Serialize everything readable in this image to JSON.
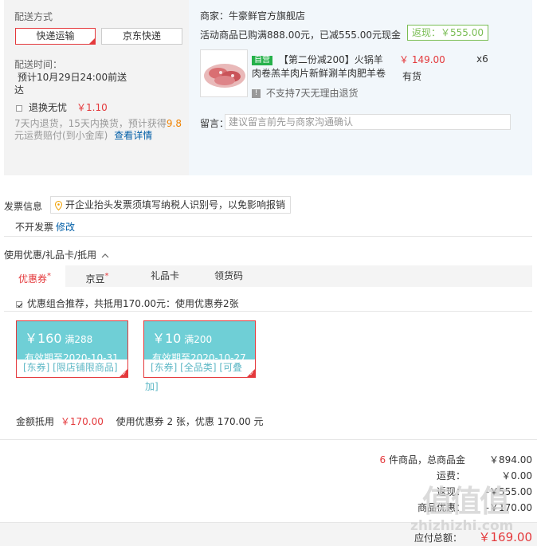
{
  "shipping": {
    "title": "配送方式",
    "options": [
      {
        "label": "快递运输",
        "selected": true
      },
      {
        "label": "京东快递",
        "selected": false
      }
    ],
    "time_label": "配送时间：",
    "time_line1": "预计10月29日24:00前送",
    "time_line2": "达",
    "return_label": "退换无忧",
    "return_price": "￥1.10",
    "return_desc1_a": "7天内退货，15天内换货，预计获得",
    "return_desc1_b": "9.8",
    "return_desc2": "元运费赔付(到小金库)",
    "return_detail_link": "查看详情"
  },
  "shop": {
    "merchant": "商家：牛豪鲜官方旗舰店",
    "promo": "活动商品已购满888.00元，已减555.00元现金",
    "rebate": "返现：￥555.00",
    "product": {
      "tag": "自营",
      "title_line1": "【第二份减200】火锅羊",
      "title_line2": "肉卷羔羊肉片新鲜涮羊肉肥羊卷",
      "price": "￥ 149.00",
      "qty": "x6",
      "stock": "有货",
      "no_return": "不支持7天无理由退货"
    },
    "message_label": "留言：",
    "message_placeholder": "建议留言前先与商家沟通确认"
  },
  "invoice": {
    "title": "发票信息",
    "tip": "开企业抬头发票须填写纳税人识别号，以免影响报销",
    "status": "不开发票",
    "edit": "修改"
  },
  "discount": {
    "title": "使用优惠/礼品卡/抵用",
    "tabs": [
      {
        "label": "优惠券",
        "star": "*",
        "active": true
      },
      {
        "label": "京豆",
        "star": "*",
        "active": false
      },
      {
        "label": "礼品卡",
        "star": "",
        "active": false
      },
      {
        "label": "领货码",
        "star": "",
        "active": false
      }
    ],
    "combo_text": "优惠组合推荐，共抵用170.00元：使用优惠券2张",
    "coupons": [
      {
        "amount": "￥160",
        "cond": "满288",
        "expiry": "有效期至2020-10-31",
        "cats": "[东券] [限店铺限商品]",
        "cats2": ""
      },
      {
        "amount": "￥10",
        "cond": "满200",
        "expiry": "有效期至2020-10-27",
        "cats": "[东券] [全品类] [可叠",
        "cats2": "加]"
      }
    ],
    "amount_label": "金额抵用",
    "amount_value": "￥170.00",
    "amount_desc": "使用优惠券 2 张，优惠 170.00 元"
  },
  "summary": {
    "count": "6",
    "count_suffix": "件商品，总商品金",
    "goods_total": "￥894.00",
    "shipping_label": "运费：",
    "shipping_value": "￥0.00",
    "cashback_label": "返现：",
    "cashback_value": "-￥555.00",
    "coupon_label": "商品优惠：",
    "coupon_value": "-￥170.00",
    "payable_label": "应付总额：",
    "payable_value": "￥169.00"
  },
  "watermark": {
    "logo": "值值值",
    "url": "zhizhizhi.com"
  }
}
